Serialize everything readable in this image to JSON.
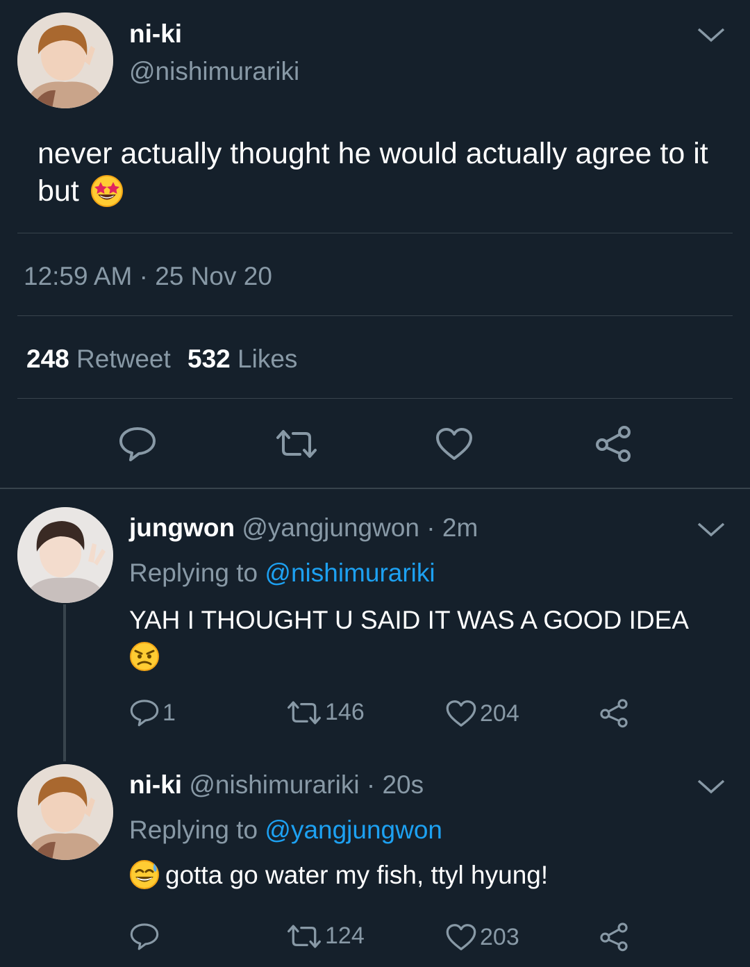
{
  "main_tweet": {
    "display_name": "ni-ki",
    "handle": "@nishimurariki",
    "text": "never actually thought he would actually agree to it but",
    "text_emoji": "star-struck-emoji",
    "time": "12:59 AM",
    "separator": "·",
    "date": "25 Nov 20",
    "retweets_count": "248",
    "retweets_label": "Retweet",
    "likes_count": "532",
    "likes_label": "Likes",
    "actions": [
      "reply-icon",
      "retweet-icon",
      "heart-icon",
      "share-icon"
    ]
  },
  "replies": [
    {
      "display_name": "jungwon",
      "handle": "@yangjungwon",
      "separator": "·",
      "age": "2m",
      "replying_label": "Replying to",
      "replying_to": "@nishimurariki",
      "text": "YAH I THOUGHT U SAID IT WAS A GOOD IDEA",
      "text_emoji": "angry-face-emoji",
      "reply_count": "1",
      "retweet_count": "146",
      "like_count": "204"
    },
    {
      "display_name": "ni-ki",
      "handle": "@nishimurariki",
      "separator": "·",
      "age": "20s",
      "replying_label": "Replying to",
      "replying_to": "@yangjungwon",
      "text_emoji": "grinning-sweat-emoji",
      "text": "gotta go water my fish, ttyl hyung!",
      "retweet_count": "124",
      "like_count": "203"
    }
  ],
  "colors": {
    "background": "#15202b",
    "muted": "#8899a6",
    "link": "#1da1f2",
    "divider": "#38444d"
  }
}
